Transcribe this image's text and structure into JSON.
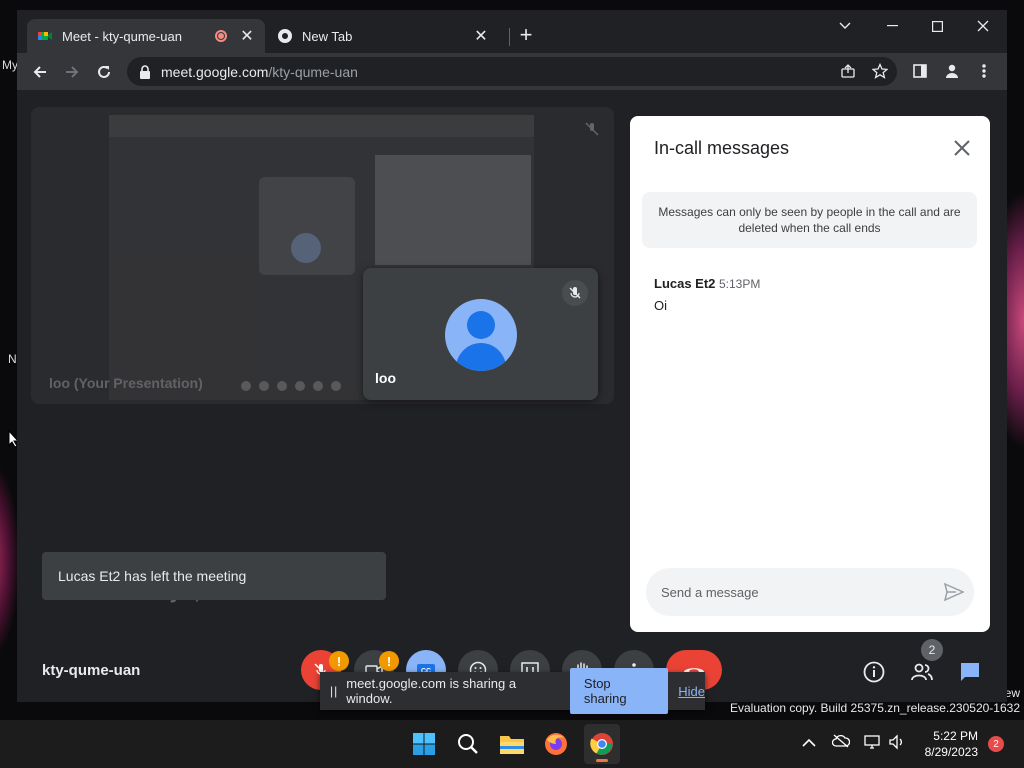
{
  "browser": {
    "tabs": [
      {
        "label": "Meet - kty-qume-uan",
        "active": true
      },
      {
        "label": "New Tab",
        "active": false
      }
    ],
    "new_tab_symbol": "+",
    "url_host": "meet.google.com",
    "url_path": "/kty-qume-uan"
  },
  "meet": {
    "presentation_label": "loo (Your Presentation)",
    "self_tile_name": "loo",
    "caption_text": "Guys, oh the flosh",
    "toast": "Lucas Et2 has left the meeting",
    "meeting_code": "kty-qume-uan",
    "participant_count": "2",
    "warning_symbol": "!"
  },
  "chat": {
    "heading": "In-call messages",
    "notice": "Messages can only be seen by people in the call and are deleted when the call ends",
    "messages": [
      {
        "sender": "Lucas Et2",
        "time": "5:13PM",
        "text": "Oi"
      }
    ],
    "input_placeholder": "Send a message"
  },
  "share_bar": {
    "pause_symbol": "||",
    "message": "meet.google.com is sharing a window.",
    "stop_label": "Stop sharing",
    "hide_label": "Hide"
  },
  "desktop": {
    "left_label": "My",
    "left_letter": "N",
    "watermark_line1": "ew",
    "watermark_line2": "Evaluation copy. Build 25375.zn_release.230520-1632"
  },
  "taskbar": {
    "time": "5:22 PM",
    "date": "8/29/2023",
    "notification_count": "2"
  },
  "colors": {
    "accent_blue": "#8ab4f8",
    "hangup_red": "#ea4335",
    "warning_orange": "#f29900"
  }
}
